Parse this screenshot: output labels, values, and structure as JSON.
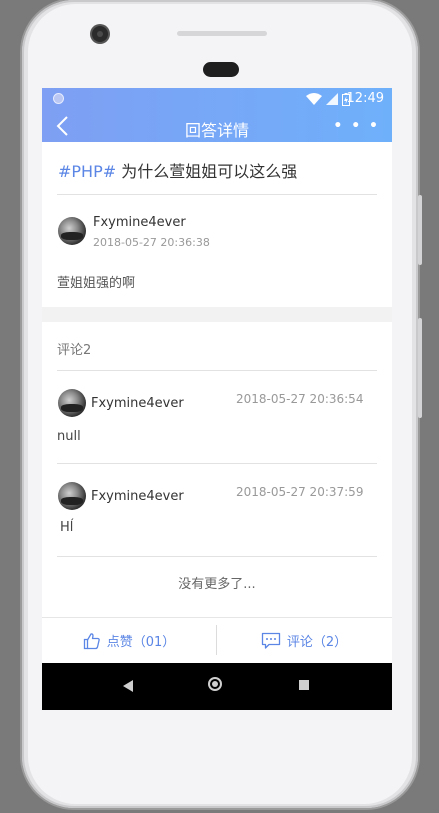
{
  "status_bar": {
    "time": "12:49"
  },
  "header": {
    "title": "回答详情",
    "more_label": "• • •"
  },
  "question": {
    "tag": "#PHP#",
    "title": " 为什么萱姐姐可以这么强"
  },
  "answer": {
    "author": "Fxymine4ever",
    "time": "2018-05-27 20:36:38",
    "body": "萱姐姐强的啊"
  },
  "comments": {
    "count_label": "评论2",
    "items": [
      {
        "author": "Fxymine4ever",
        "time": "2018-05-27 20:36:54",
        "body": "null"
      },
      {
        "author": "Fxymine4ever",
        "time": "2018-05-27 20:37:59",
        "body": "Hĺ"
      }
    ],
    "no_more": "没有更多了..."
  },
  "actions": {
    "like_label": "点赞（01）",
    "comment_label": "评论（2）"
  },
  "colors": {
    "accent": "#5b86e5",
    "header_start": "#7e9ff3",
    "header_end": "#6fb0fb"
  },
  "icons": {
    "back": "back-arrow-icon",
    "like": "thumbs-up-icon",
    "comment": "comment-bubble-icon"
  }
}
